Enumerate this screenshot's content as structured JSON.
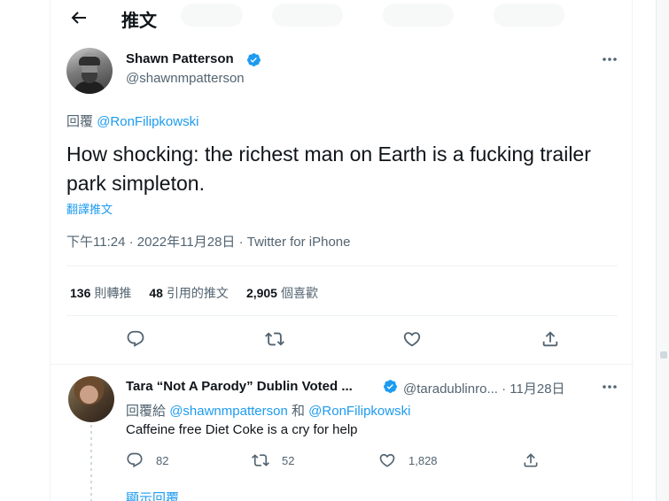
{
  "header": {
    "title": "推文"
  },
  "tweet": {
    "author_name": "Shawn Patterson",
    "author_handle": "@shawnmpatterson",
    "replying_prefix": "回覆",
    "replying_to": "@RonFilipkowski",
    "text": "How shocking: the richest man on Earth is a fucking trailer park simpleton.",
    "translate_label": "翻譯推文",
    "time": "下午11:24",
    "date": "2022年11月28日",
    "source": "Twitter for iPhone",
    "retweets_count": "136",
    "retweets_label": "則轉推",
    "quotes_count": "48",
    "quotes_label": "引用的推文",
    "likes_count": "2,905",
    "likes_label": "個喜歡"
  },
  "reply": {
    "author_name": "Tara “Not A Parody” Dublin Voted ...",
    "author_handle": "@taradublinro...",
    "date": "11月28日",
    "replying_prefix": "回覆給",
    "replying_to_1": "@shawnmpatterson",
    "replying_and": "和",
    "replying_to_2": "@RonFilipkowski",
    "text": "Caffeine free Diet Coke is a cry for help",
    "reply_count": "82",
    "retweet_count": "52",
    "like_count": "1,828",
    "show_replies": "顯示回覆"
  },
  "icons": {
    "back": "arrow-left-icon",
    "verified": "verified-badge-icon",
    "more": "more-horizontal-icon",
    "reply": "reply-icon",
    "retweet": "retweet-icon",
    "like": "heart-icon",
    "share": "share-icon"
  },
  "colors": {
    "accent": "#1d9bf0",
    "text": "#0f1419",
    "secondary": "#536471",
    "border": "#eff3f4"
  }
}
